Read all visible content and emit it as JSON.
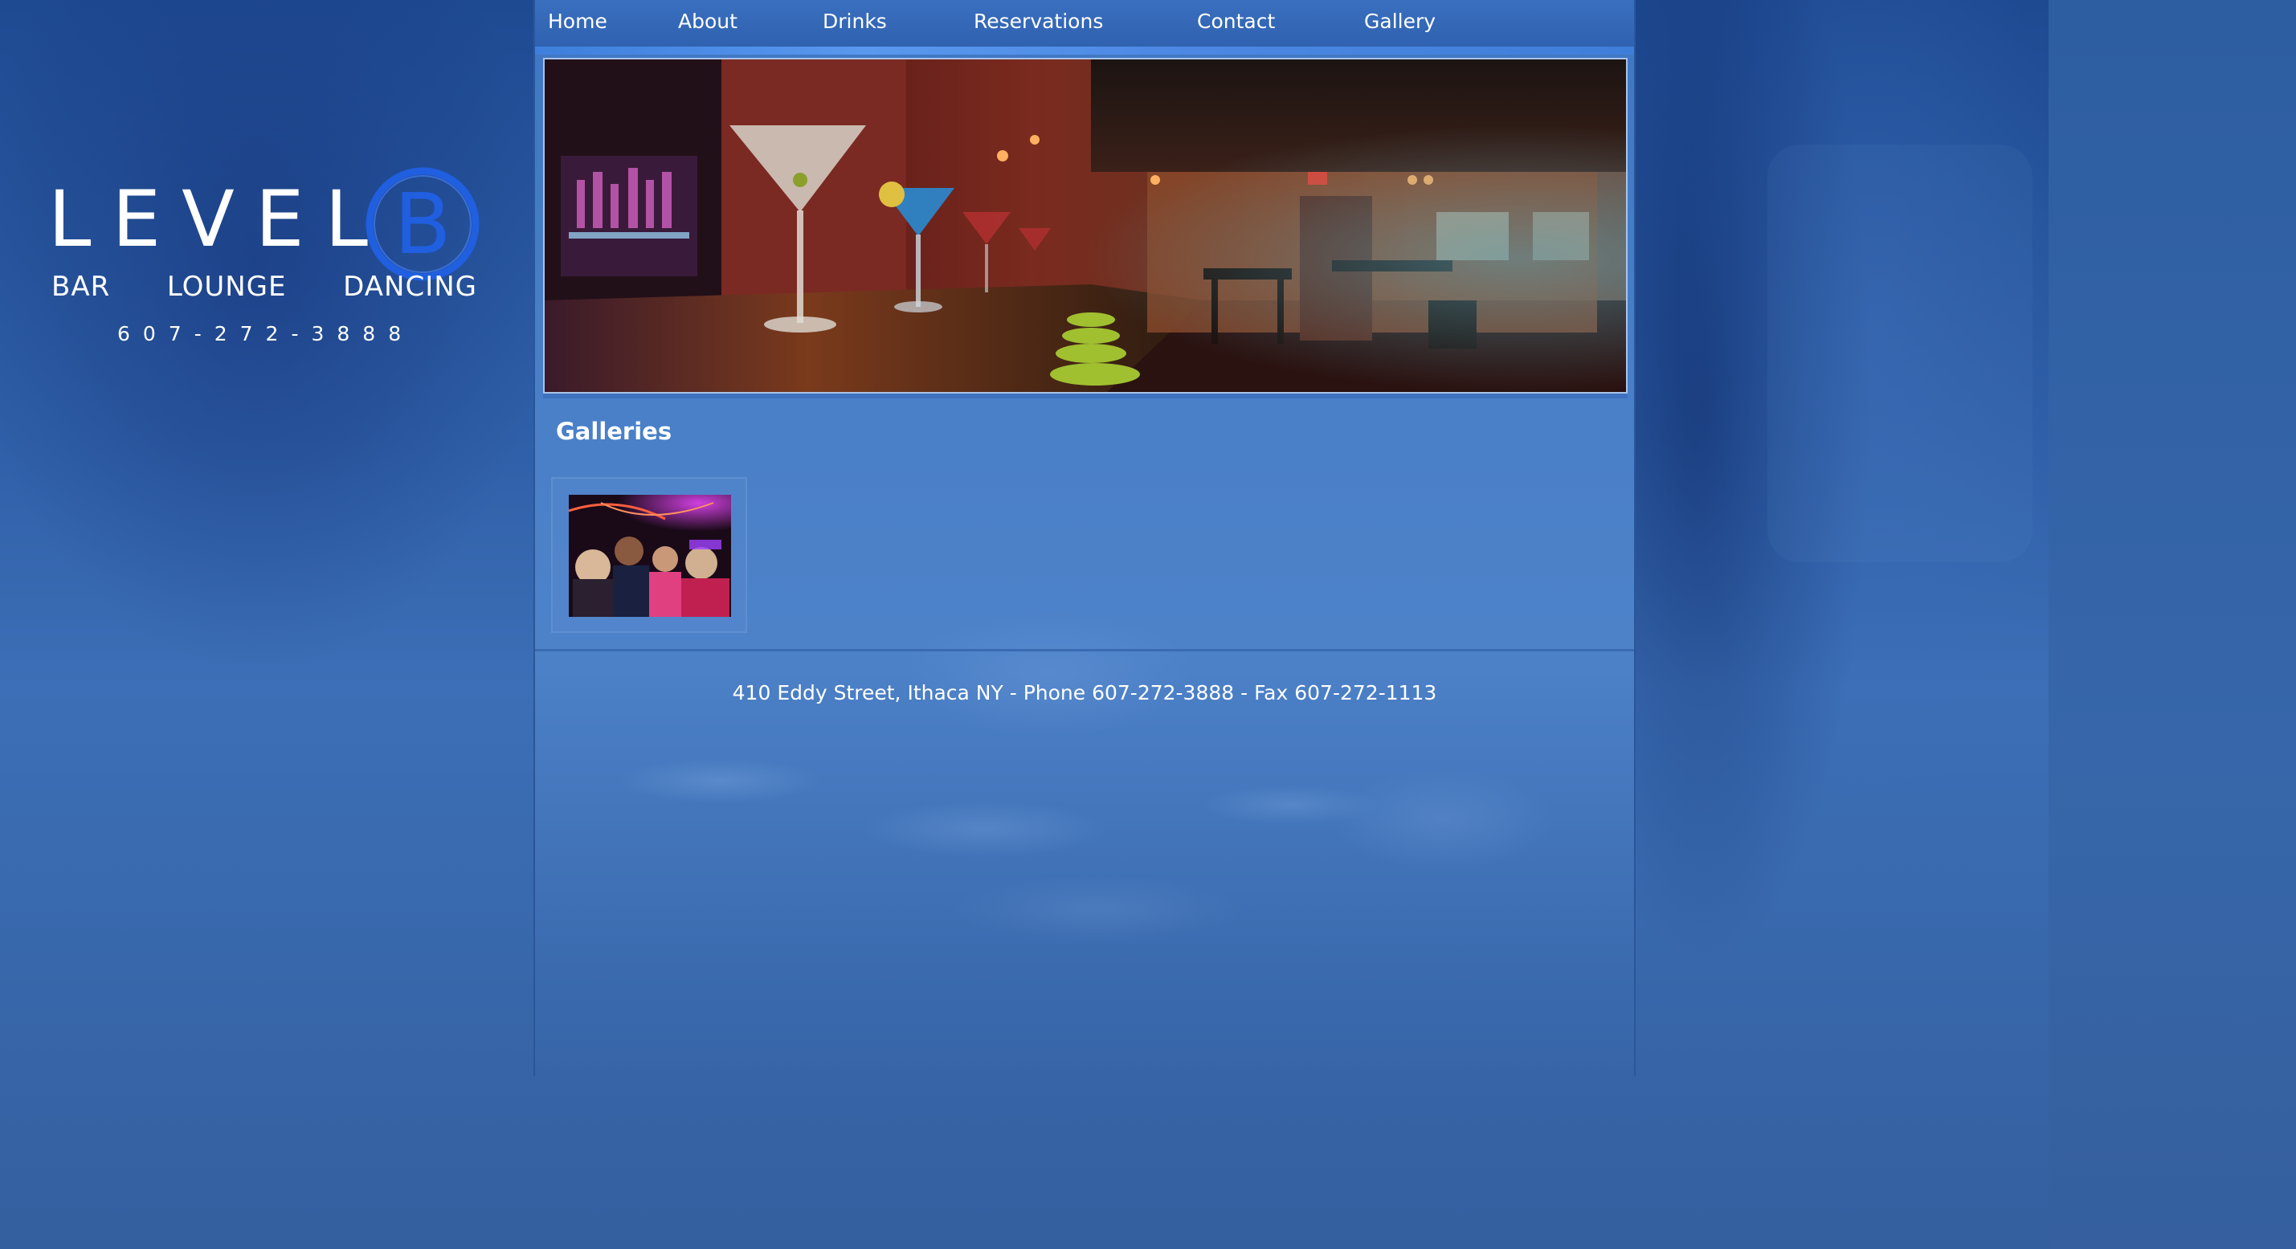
{
  "logo": {
    "word": "LEVEL",
    "letter": "B",
    "tagline": [
      "BAR",
      "LOUNGE",
      "DANCING"
    ],
    "phone": "607-272-3888",
    "accent_color": "#1f5fe0"
  },
  "nav": {
    "items": [
      {
        "label": "Home"
      },
      {
        "label": "About"
      },
      {
        "label": "Drinks"
      },
      {
        "label": "Reservations"
      },
      {
        "label": "Contact"
      },
      {
        "label": "Gallery"
      }
    ]
  },
  "hero": {
    "icon": "bar-interior-photo"
  },
  "main": {
    "title": "Galleries",
    "gallery_thumbnail_icon": "party-crowd-photo"
  },
  "footer": {
    "text": "410 Eddy Street, Ithaca NY - Phone 607-272-3888 - Fax 607-272-1113"
  }
}
